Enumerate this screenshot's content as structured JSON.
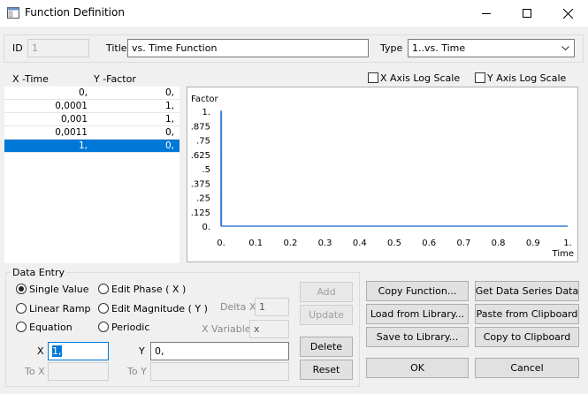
{
  "window": {
    "title": "Function Definition"
  },
  "header": {
    "id_label": "ID",
    "id_value": "1",
    "title_label": "Title",
    "title_value": "vs. Time Function",
    "type_label": "Type",
    "type_value": "1..vs. Time"
  },
  "table": {
    "col_x": "X -Time",
    "col_y": "Y -Factor",
    "rows": [
      {
        "x": "0,",
        "y": "0,"
      },
      {
        "x": "0,0001",
        "y": "1,"
      },
      {
        "x": "0,001",
        "y": "1,"
      },
      {
        "x": "0,0011",
        "y": "0,"
      },
      {
        "x": "1,",
        "y": "0,"
      }
    ],
    "selected_row": 4
  },
  "plot_options": {
    "x_log_label": "X Axis Log Scale",
    "y_log_label": "Y Axis Log Scale"
  },
  "chart_data": {
    "type": "line",
    "ylabel": "Factor",
    "xlabel": "Time",
    "x_ticks": [
      "0.",
      "0.1",
      "0.2",
      "0.3",
      "0.4",
      "0.5",
      "0.6",
      "0.7",
      "0.8",
      "0.9",
      "1."
    ],
    "y_ticks": [
      "1.",
      ".875",
      ".75",
      ".625",
      ".5",
      ".375",
      ".25",
      ".125",
      "0."
    ],
    "xlim": [
      0,
      1
    ],
    "ylim": [
      0,
      1
    ],
    "series": [
      {
        "x": [
          0,
          0.0001,
          0.001,
          0.0011,
          1
        ],
        "y": [
          0,
          1,
          1,
          0,
          0
        ]
      }
    ],
    "line_color": "#3b7bd4"
  },
  "data_entry": {
    "group_label": "Data Entry",
    "modes": {
      "single_value": "Single Value",
      "linear_ramp": "Linear Ramp",
      "equation": "Equation",
      "edit_phase": "Edit Phase ( X )",
      "edit_magnitude": "Edit Magnitude ( Y )",
      "periodic": "Periodic"
    },
    "delta_x_label": "Delta X",
    "delta_x_value": "1",
    "x_variable_label": "X Variable",
    "x_variable_value": "x",
    "x_label": "X",
    "x_value": "1,",
    "y_label": "Y",
    "y_value": "0,",
    "to_x_label": "To X",
    "to_y_label": "To Y",
    "add": "Add",
    "update": "Update",
    "delete": "Delete",
    "reset": "Reset"
  },
  "actions": {
    "copy_function": "Copy Function...",
    "get_data_series": "Get Data Series Data",
    "load_library": "Load from Library...",
    "paste_clipboard": "Paste from Clipboard",
    "save_library": "Save to Library...",
    "copy_clipboard": "Copy to Clipboard",
    "ok": "OK",
    "cancel": "Cancel"
  }
}
